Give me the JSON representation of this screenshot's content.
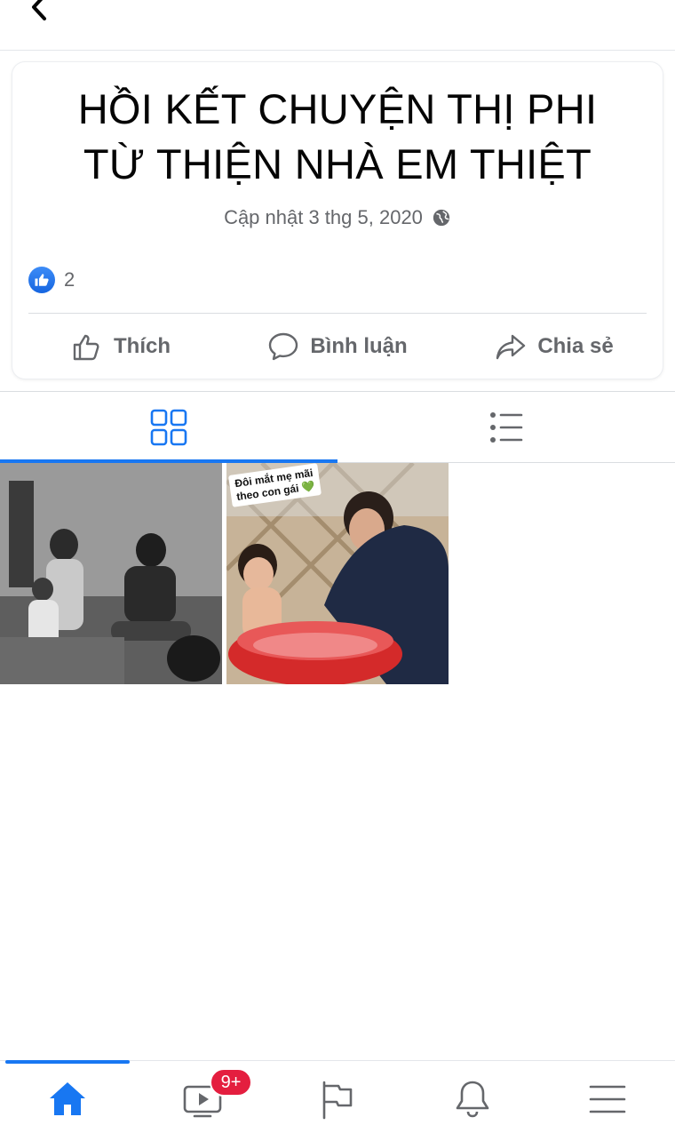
{
  "album": {
    "title_line1": "HỒI KẾT CHUYỆN THỊ PHI",
    "title_line2": "TỪ THIỆN NHÀ EM THIỆT",
    "updated": "Cập nhật 3 thg 5, 2020",
    "privacy_icon": "globe-icon",
    "reaction_icon": "like-icon",
    "reaction_count": "2"
  },
  "actions": [
    {
      "label": "Thích",
      "icon": "thumbs-up-icon"
    },
    {
      "label": "Bình luận",
      "icon": "comment-icon"
    },
    {
      "label": "Chia sẻ",
      "icon": "share-icon"
    }
  ],
  "view_tabs": [
    {
      "name": "grid-view",
      "icon": "grid-icon",
      "active": true
    },
    {
      "name": "list-view",
      "icon": "list-icon",
      "active": false
    }
  ],
  "photos": [
    {
      "name": "photo-1",
      "description": "black and white family photo"
    },
    {
      "name": "photo-2",
      "sticker_line1": "Đôi mắt mẹ mãi",
      "sticker_line2": "theo con gái 💚"
    }
  ],
  "bottom_nav": [
    {
      "name": "home",
      "icon": "home-icon",
      "active": true
    },
    {
      "name": "watch",
      "icon": "video-icon",
      "badge": "9+"
    },
    {
      "name": "pages",
      "icon": "flag-icon"
    },
    {
      "name": "notifications",
      "icon": "bell-icon"
    },
    {
      "name": "menu",
      "icon": "menu-icon"
    }
  ],
  "colors": {
    "accent": "#1877f2",
    "badge": "#e41e3f",
    "secondary_text": "#65676b"
  }
}
